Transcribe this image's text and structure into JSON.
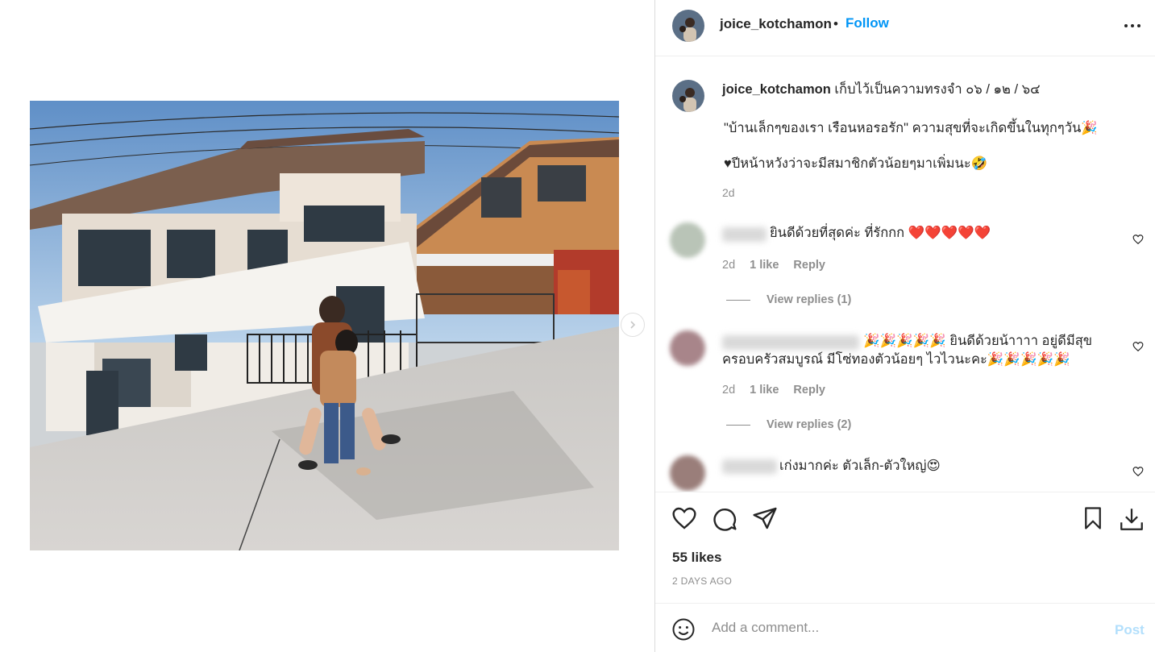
{
  "header": {
    "username": "joice_kotchamon",
    "dot": "•",
    "follow_label": "Follow",
    "more_icon": "more-horizontal-icon"
  },
  "caption": {
    "username": "joice_kotchamon",
    "line1": "เก็บไว้เป็นความทรงจำ ๐๖ / ๑๒ / ๖๔",
    "line2": "\"บ้านเล็กๆของเรา เรือนหอรอรัก\" ความสุขที่จะเกิดขึ้นในทุกๆวัน🎉",
    "line3": "♥ปีหน้าหวังว่าจะมีสมาชิกตัวน้อยๆมาเพิ่มนะ🤣",
    "time": "2d"
  },
  "comments": [
    {
      "text": "ยินดีด้วยที่สุดค่ะ ที่รักกก ❤️❤️❤️❤️❤️",
      "time": "2d",
      "likes": "1 like",
      "reply_label": "Reply",
      "view_replies": "View replies (1)"
    },
    {
      "text_line1": "🎉🎉🎉🎉🎉 ยินดีด้วยน้าาาา อยู่ดีมีสุข",
      "text_line2": "ครอบครัวสมบูรณ์ มีโซ่ทองตัวน้อยๆ ไวไวนะคะ🎉🎉🎉🎉🎉",
      "time": "2d",
      "likes": "1 like",
      "reply_label": "Reply",
      "view_replies": "View replies (2)"
    },
    {
      "text": "เก่งมากค่ะ ตัวเล็ก-ตัวใหญ่😍"
    }
  ],
  "actions": {
    "likes": "55 likes",
    "ago": "2 DAYS AGO"
  },
  "add_comment": {
    "placeholder": "Add a comment...",
    "post_label": "Post"
  },
  "colors": {
    "accent": "#0095f6",
    "post_disabled": "#b2dffc",
    "muted": "#8e8e8e"
  }
}
